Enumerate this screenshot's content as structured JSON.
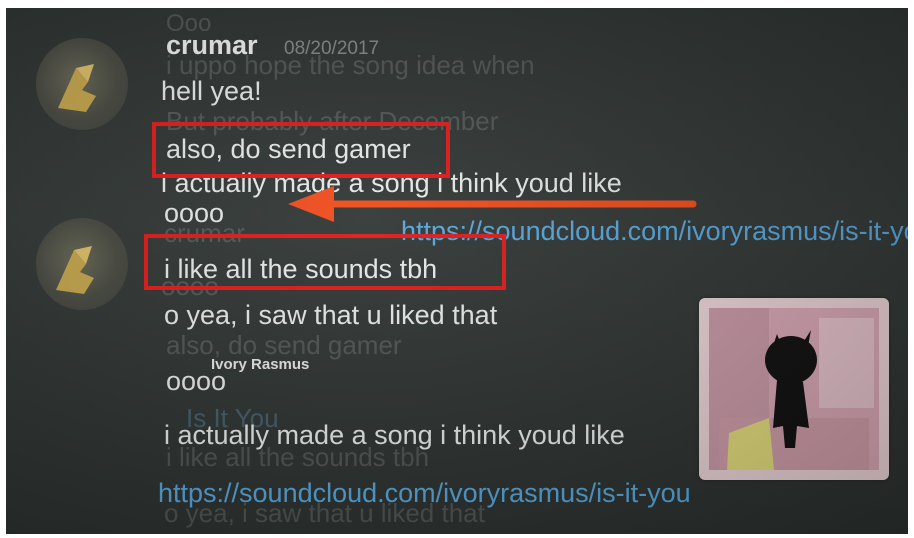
{
  "ghost_lines": [
    "Ooo",
    "i uppo hope the song idea when",
    "But probably after December",
    "crumar",
    "oooo",
    "also, do send gamer",
    "Is It You",
    "i like all the sounds tbh",
    "o yea, i saw that u liked that",
    "o yea"
  ],
  "ghost_links": [
    "https://soundcloud.com/ivoryrasmus/is-it-you"
  ],
  "messages": [
    {
      "author": "crumar",
      "timestamp": "08/20/2017",
      "lines": [
        "hell yea!",
        "also, do send gamer",
        "i actually made a song i think youd like",
        "oooo"
      ]
    },
    {
      "author": "",
      "timestamp": "",
      "lines": [
        "i like all the sounds tbh",
        "o yea, i saw that u liked that",
        "oooo",
        "i actually made a song i think youd like"
      ]
    }
  ],
  "links": {
    "top": "https://soundcloud.com/ivoryrasmus/is-it-you",
    "bottom": "https://soundcloud.com/ivoryrasmus/is-it-you"
  },
  "embed": {
    "provider": "Ivory Rasmus",
    "title": "Is It You"
  },
  "colors": {
    "highlight": "#e21c1c",
    "arrow": "#f04e1e",
    "link": "#58a9df",
    "background": "#313735"
  },
  "icons": [
    "avatar-image",
    "arrow-left-annotation",
    "album-art-thumbnail"
  ]
}
